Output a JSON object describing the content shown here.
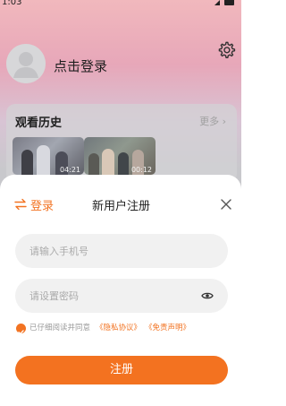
{
  "status_bar": {
    "time": "1:03",
    "icons": [
      "signal-icon",
      "battery-icon"
    ]
  },
  "profile": {
    "login_prompt": "点击登录",
    "settings_icon": "gear-icon"
  },
  "history": {
    "title": "观看历史",
    "more_label": "更多 ›",
    "items": [
      {
        "duration": "04:21"
      },
      {
        "duration": "00:12"
      }
    ]
  },
  "register_sheet": {
    "switch_login_label": "登录",
    "title": "新用户注册",
    "phone_placeholder": "请输入手机号",
    "password_placeholder": "请设置密码",
    "agreement_text": "已仔细阅读并同意",
    "privacy_link": "《隐私协议》",
    "disclaimer_link": "《免责声明》",
    "register_label": "注册",
    "colors": {
      "accent": "#f37220",
      "field_background": "#f1f1f1"
    }
  }
}
